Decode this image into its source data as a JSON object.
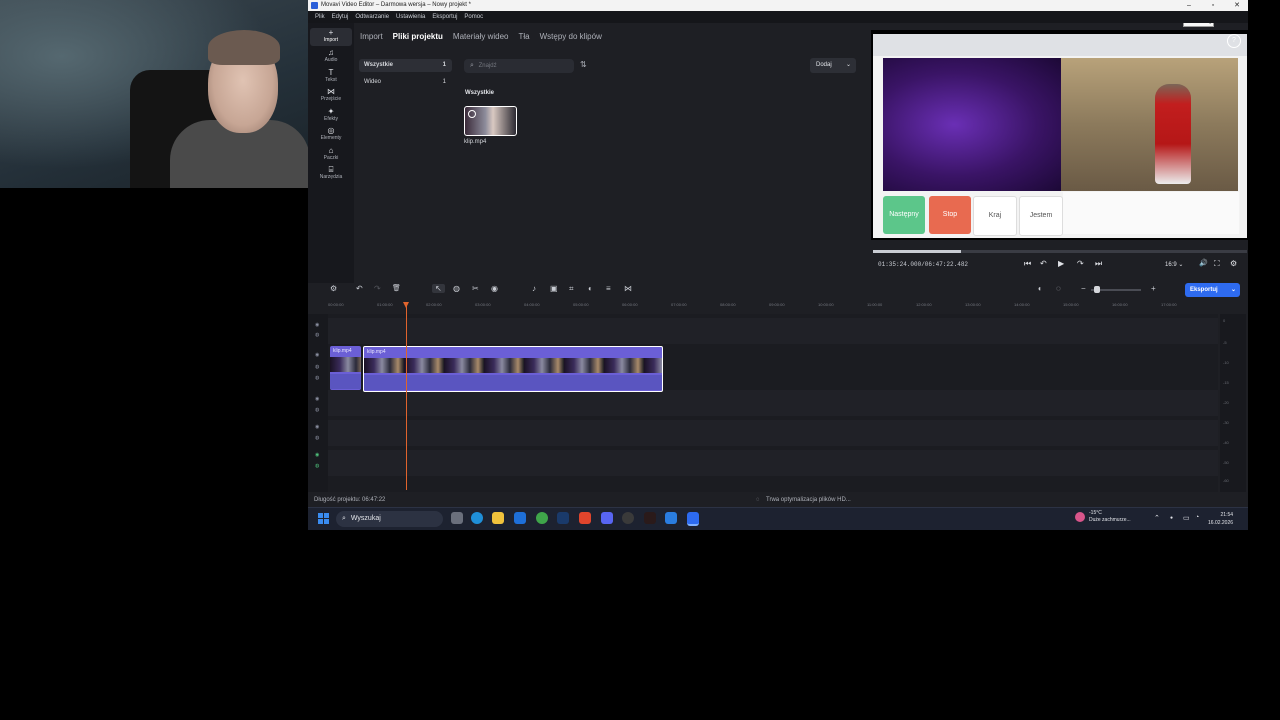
{
  "window": {
    "title": "Movavi Video Editor – Darmowa wersja – Nowy projekt *",
    "minimize": "–",
    "maximize": "▫",
    "close": "✕",
    "tooltip": "Minimalizuj"
  },
  "menu": [
    "Plik",
    "Edytuj",
    "Odtwarzanie",
    "Ustawienia",
    "Eksportuj",
    "Pomoc"
  ],
  "sidebar": {
    "items": [
      {
        "icon": "+",
        "label": "Import"
      },
      {
        "icon": "♫",
        "label": "Audio"
      },
      {
        "icon": "T",
        "label": "Tekst"
      },
      {
        "icon": "⋈",
        "label": "Przejście"
      },
      {
        "icon": "✦",
        "label": "Efekty"
      },
      {
        "icon": "◎",
        "label": "Elementy"
      },
      {
        "icon": "⌂",
        "label": "Paczki"
      },
      {
        "icon": "⌸",
        "label": "Narzędzia"
      }
    ]
  },
  "import_panel": {
    "tabs": [
      "Import",
      "Pliki projektu",
      "Materiały wideo",
      "Tła",
      "Wstępy do klipów"
    ],
    "categories": [
      {
        "label": "Wszystkie",
        "count": "1"
      },
      {
        "label": "Wideo",
        "count": "1"
      }
    ],
    "search_placeholder": "Znajdź",
    "sort_icon": "⇅",
    "add_button": "Dodaj",
    "add_chevron": "⌄",
    "group_label": "Wszystkie",
    "file_name": "klip.mp4"
  },
  "preview": {
    "buttons": [
      {
        "label": "Następny",
        "color": "#5cc68a",
        "text_color": "#ffffff"
      },
      {
        "label": "Stop",
        "color": "#e86a50",
        "text_color": "#ffffff"
      },
      {
        "label": "Kraj",
        "color": "#ffffff",
        "text_color": "#555555"
      },
      {
        "label": "Jestem",
        "color": "#ffffff",
        "text_color": "#555555"
      }
    ],
    "help": "?",
    "progress_fraction": 0.236,
    "timecode": "01:35:24.000/06:47:22.482",
    "aspect": "16:9",
    "controls": {
      "skip_back": "⏮",
      "rewind": "↶",
      "play": "▶",
      "forward": "↷",
      "skip_forward": "⏭",
      "aspect_chevron": "⌄",
      "volume": "🔊",
      "fullscreen": "⛶",
      "settings": "⚙"
    }
  },
  "timeline": {
    "ruler": [
      "00:00:00",
      "01:00:00",
      "02:00:00",
      "03:00:00",
      "04:00:00",
      "05:00:00",
      "06:00:00",
      "07:00:00",
      "08:00:00",
      "09:00:00",
      "10:00:00",
      "11:00:00",
      "12:00:00",
      "13:00:00",
      "14:00:00",
      "15:00:00",
      "16:00:00",
      "17:00:00"
    ],
    "clip_label": "klip.mp4",
    "export_button": "Eksportuj",
    "export_chevron": "⌄",
    "meter_ticks": [
      "0",
      "-5",
      "-10",
      "-15",
      "-20",
      "-30",
      "-40",
      "-50",
      "-60"
    ],
    "tools": {
      "settings": "⚙",
      "undo": "↶",
      "redo": "↷",
      "delete": "🗑",
      "select": "↖",
      "split": "◍",
      "cut": "✂",
      "marker": "◉",
      "audio": "♪",
      "crop_frame": "▣",
      "crop": "⌗",
      "color": "◐",
      "adjust": "≡",
      "transitions": "⋈",
      "mute": "◖",
      "record": "◌",
      "zoom_out": "−",
      "zoom_in": "+"
    }
  },
  "status": {
    "duration": "Długość projektu: 06:47:22",
    "optimizing": "Trwa optymalizacja plików HD...",
    "spinner": "◌"
  },
  "taskbar": {
    "search": "Wyszukaj",
    "search_icon": "⌕",
    "weather_temp": "-15°C",
    "weather_desc": "Duże zachmurze...",
    "time": "21:54",
    "date": "16.02.2026",
    "tray": {
      "chevron": "⌃",
      "mic": "●",
      "monitor": "▭",
      "speaker": "◔"
    }
  }
}
